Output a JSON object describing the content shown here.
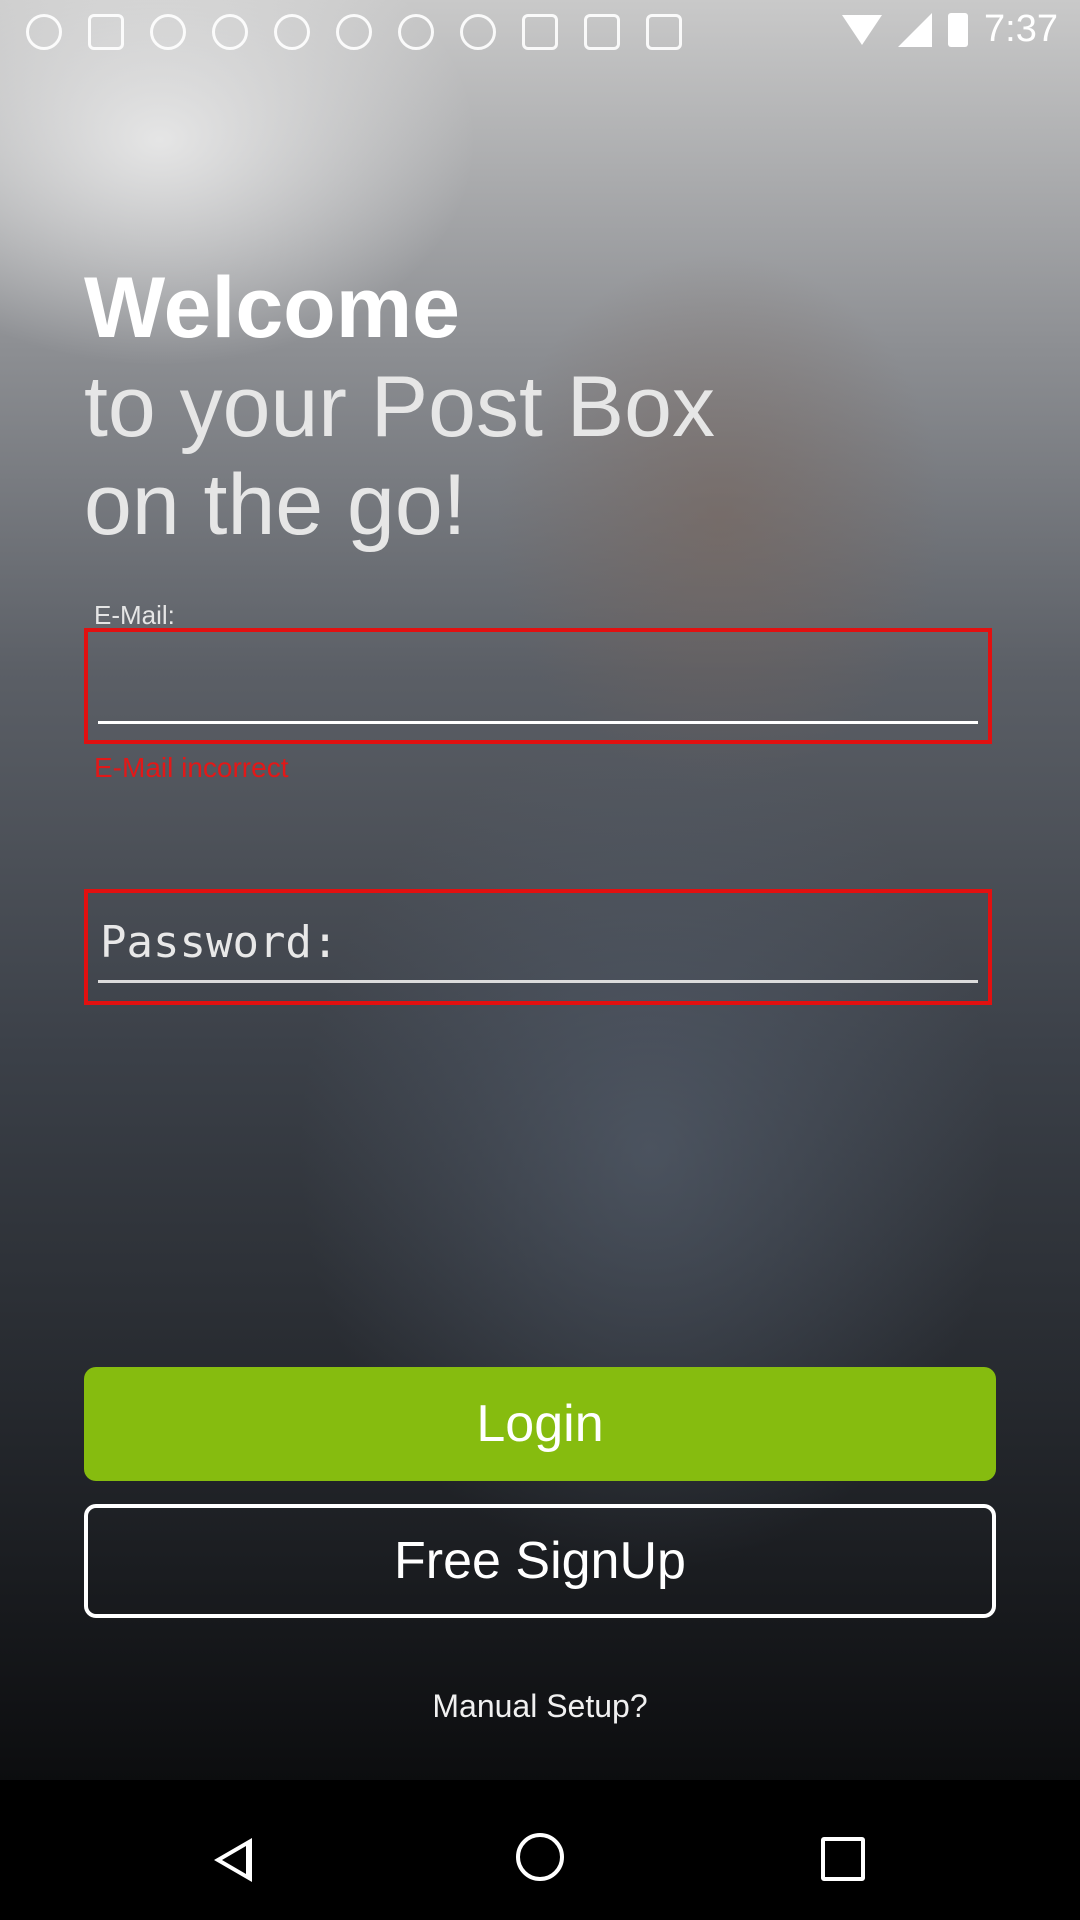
{
  "status_bar": {
    "time": "7:37",
    "left_icons": [
      "app-icon",
      "facebook-icon",
      "cloud-icon",
      "cloud-icon",
      "cloud-icon",
      "cloud-icon",
      "cloud-icon",
      "info-icon",
      "fake-gps-icon",
      "lock-icon",
      "android-icon"
    ],
    "right_icons": [
      "wifi-icon",
      "signal-icon",
      "battery-icon"
    ]
  },
  "headline": {
    "line1": "Welcome",
    "line2": "to your Post Box",
    "line3": "on the go!"
  },
  "form": {
    "email_label": "E-Mail:",
    "email_value": "",
    "email_error": "E-Mail incorrect",
    "password_placeholder": "Password:",
    "password_value": ""
  },
  "buttons": {
    "login": "Login",
    "signup": "Free SignUp",
    "manual_setup": "Manual Setup?"
  },
  "colors": {
    "accent_green": "#86bc0f",
    "error_red": "#e21010"
  },
  "navbar": {
    "icons": [
      "back-icon",
      "home-icon",
      "recents-icon"
    ]
  }
}
